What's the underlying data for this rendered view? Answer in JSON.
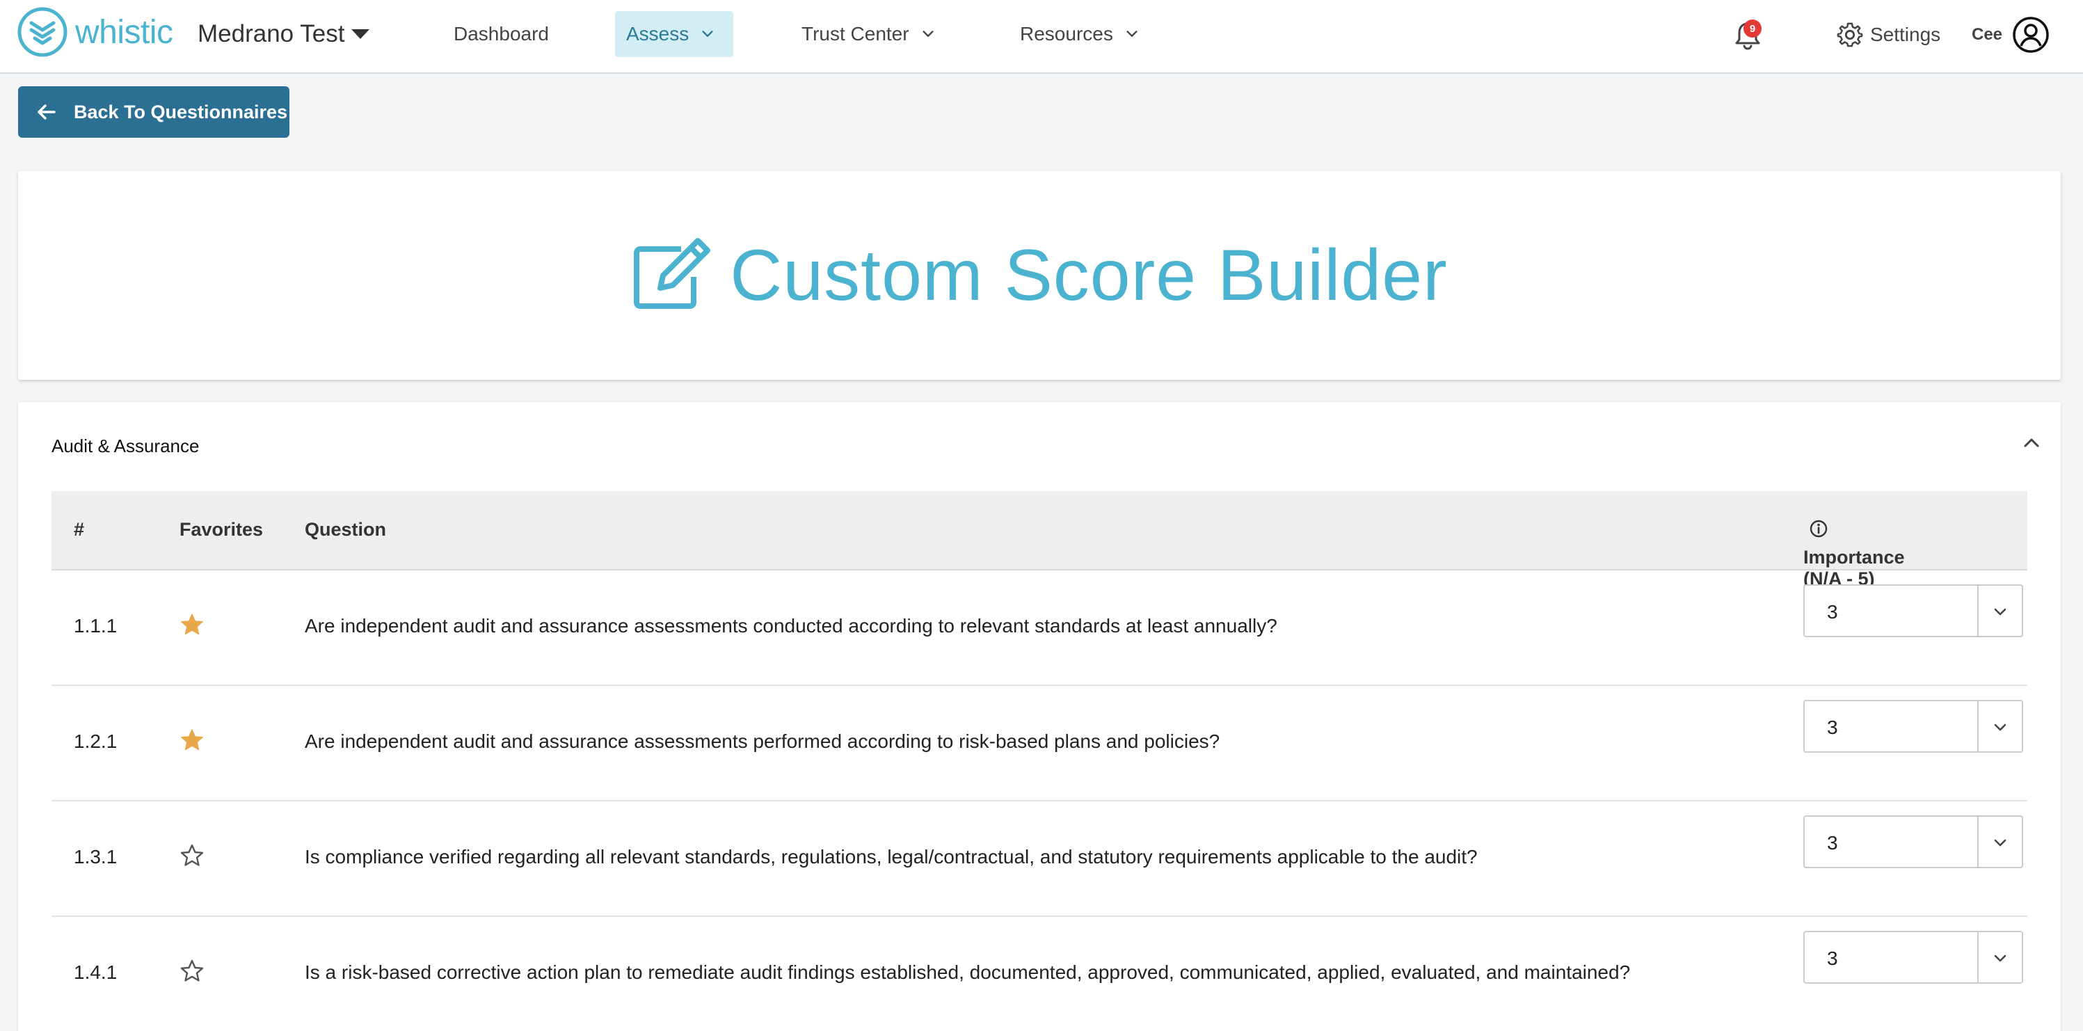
{
  "brand": {
    "name": "whistic",
    "color": "#4bb3cf"
  },
  "org": {
    "name": "Medrano Test"
  },
  "nav": {
    "items": [
      {
        "label": "Dashboard"
      },
      {
        "label": "Assess",
        "active": true
      },
      {
        "label": "Trust Center"
      },
      {
        "label": "Resources"
      }
    ],
    "notifications_count": "9",
    "settings_label": "Settings",
    "user_label": "Cee"
  },
  "back_button": {
    "label": "Back To Questionnaires"
  },
  "hero": {
    "title": "Custom Score Builder",
    "icon": "edit-icon"
  },
  "section": {
    "title": "Audit & Assurance",
    "columns": {
      "num": "#",
      "favorites": "Favorites",
      "question": "Question",
      "importance": "Importance (N/A - 5)"
    },
    "rows": [
      {
        "num": "1.1.1",
        "favorite": true,
        "question": "Are independent audit and assurance assessments conducted according to relevant standards at least annually?",
        "importance": "3"
      },
      {
        "num": "1.2.1",
        "favorite": true,
        "question": "Are independent audit and assurance assessments performed according to risk-based plans and policies?",
        "importance": "3"
      },
      {
        "num": "1.3.1",
        "favorite": false,
        "question": "Is compliance verified regarding all relevant standards, regulations, legal/contractual, and statutory requirements applicable to the audit?",
        "importance": "3"
      },
      {
        "num": "1.4.1",
        "favorite": false,
        "question": "Is a risk-based corrective action plan to remediate audit findings established, documented, approved, communicated, applied, evaluated, and maintained?",
        "importance": "3"
      }
    ]
  },
  "colors": {
    "primary_button": "#2b6f93",
    "active_nav_bg": "#d3edf4",
    "star_filled": "#e8a84a",
    "badge": "#e53935"
  }
}
